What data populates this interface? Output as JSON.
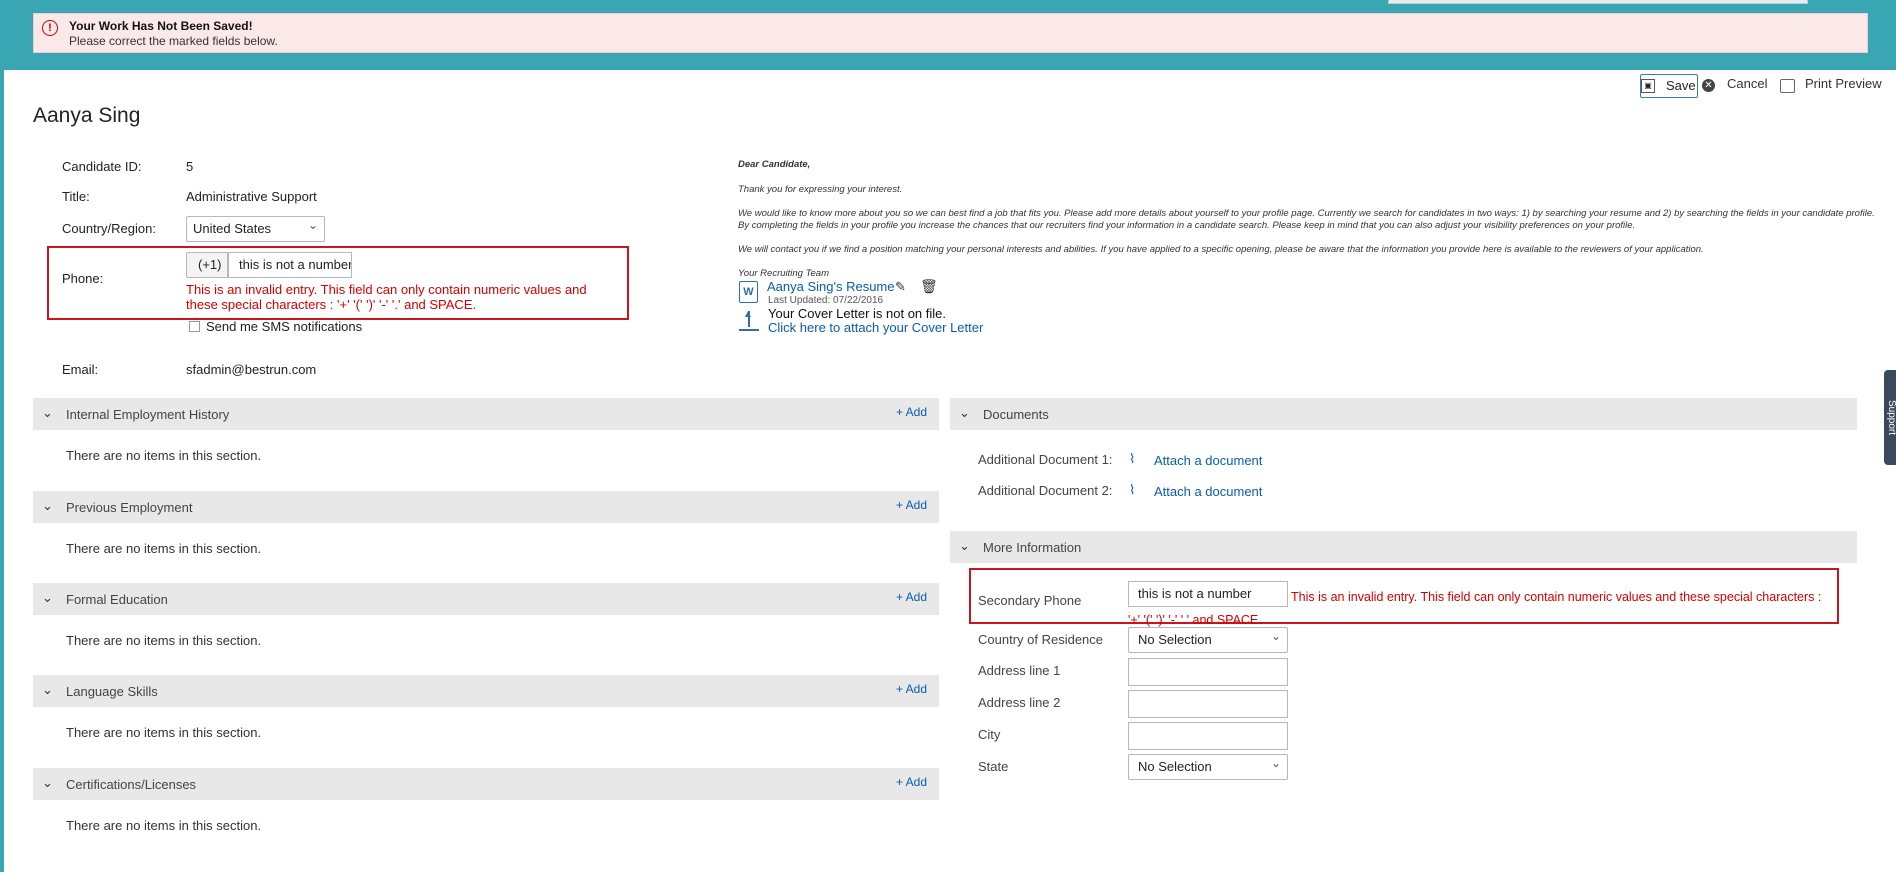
{
  "banner": {
    "icon": "error-icon",
    "title": "Your Work Has Not Been Saved!",
    "message": "Please correct the marked fields below."
  },
  "toolbar": {
    "save_label": "Save",
    "cancel_label": "Cancel",
    "print_label": "Print Preview"
  },
  "candidate": {
    "name": "Aanya Sing",
    "id_label": "Candidate ID:",
    "id_value": "5",
    "title_label": "Title:",
    "title_value": "Administrative Support",
    "country_label": "Country/Region:",
    "country_value": "United States",
    "phone_label": "Phone:",
    "phone_code": "(+1)",
    "phone_value": "this is not a number",
    "phone_error": "This is an invalid entry. This field can only contain numeric values and these special characters : '+' '(' ')' '-' '.' and SPACE.",
    "sms_label": "Send me SMS notifications",
    "email_label": "Email:",
    "email_value": "sfadmin@bestrun.com"
  },
  "letter": {
    "salutation": "Dear Candidate,",
    "p1": "Thank you for expressing your interest.",
    "p2": "We would like to know more about you so we can best find a job that fits you. Please add more details about yourself to your profile page. Currently we search for candidates in two ways: 1) by searching your resume and 2) by searching the fields in your candidate profile. By completing the fields in your profile you increase the chances that our recruiters find your information in a candidate search. Please keep in mind that you can also adjust your visibility preferences on your profile.",
    "p3": "We will contact you if we find a position matching your personal interests and abilities. If you have applied to a specific opening, please be aware that the information you provide here is available to the reviewers of your application.",
    "signature": "Your Recruiting Team"
  },
  "attachments": {
    "resume_link": "Aanya Sing's Resume",
    "resume_updated": "Last Updated: 07/22/2016",
    "cover_status": "Your Cover Letter is not on file.",
    "cover_link": "Click here to attach your Cover Letter"
  },
  "left_sections": [
    {
      "title": "Internal Employment History",
      "add": "+ Add",
      "empty": "There are no items in this section."
    },
    {
      "title": "Previous Employment",
      "add": "+ Add",
      "empty": "There are no items in this section."
    },
    {
      "title": "Formal Education",
      "add": "+ Add",
      "empty": "There are no items in this section."
    },
    {
      "title": "Language Skills",
      "add": "+ Add",
      "empty": "There are no items in this section."
    },
    {
      "title": "Certifications/Licenses",
      "add": "+ Add",
      "empty": "There are no items in this section."
    }
  ],
  "documents": {
    "title": "Documents",
    "doc1_label": "Additional Document 1:",
    "doc2_label": "Additional Document 2:",
    "attach_label": "Attach a document"
  },
  "more_info": {
    "title": "More Information",
    "secondary_phone_label": "Secondary Phone",
    "secondary_phone_value": "this is not a number",
    "secondary_phone_error": "This is an invalid entry. This field can only contain numeric values and these special characters : '+' '(' ')' '-' '.' and SPACE.",
    "country_label": "Country of Residence",
    "country_value": "No Selection",
    "addr1_label": "Address line 1",
    "addr2_label": "Address line 2",
    "city_label": "City",
    "state_label": "State",
    "state_value": "No Selection"
  },
  "support_label": "Support",
  "colors": {
    "header": "#3aa6b4",
    "error": "#c9161d",
    "link": "#0a5cae"
  }
}
